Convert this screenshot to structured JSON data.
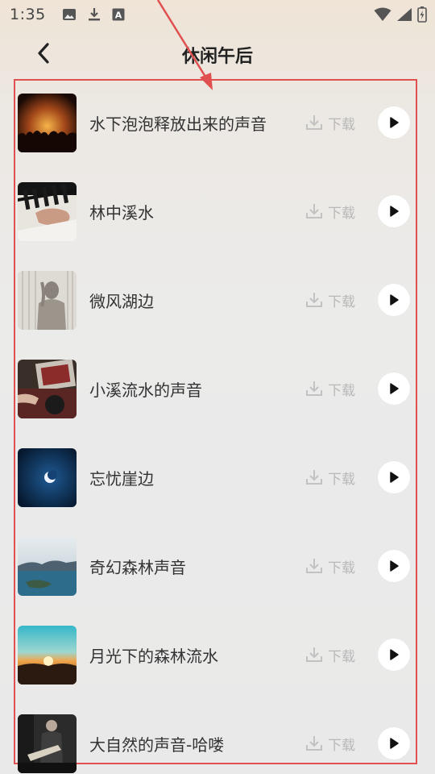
{
  "status_bar": {
    "time": "1:35",
    "left_icons": [
      "image-icon",
      "download-icon",
      "font-icon"
    ],
    "right_icons": [
      "wifi-icon",
      "signal-icon",
      "battery-icon"
    ]
  },
  "header": {
    "title": "休闲午后",
    "back_icon": "chevron-left-icon"
  },
  "tracks": [
    {
      "title": "水下泡泡释放出来的声音",
      "download_label": "下载",
      "thumb": "concert-crowd"
    },
    {
      "title": "林中溪水",
      "download_label": "下载",
      "thumb": "piano-hands"
    },
    {
      "title": "微风湖边",
      "download_label": "下载",
      "thumb": "curtain-silhouette"
    },
    {
      "title": "小溪流水的声音",
      "download_label": "下载",
      "thumb": "vinyl-player"
    },
    {
      "title": "忘忧崖边",
      "download_label": "下载",
      "thumb": "moon-night"
    },
    {
      "title": "奇幻森林声音",
      "download_label": "下载",
      "thumb": "coast-island"
    },
    {
      "title": "月光下的森林流水",
      "download_label": "下载",
      "thumb": "sunset-hills"
    },
    {
      "title": "大自然的声音-哈喽",
      "download_label": "下载",
      "thumb": "guitar-player"
    }
  ],
  "colors": {
    "annotation_red": "#e05050",
    "download_gray": "#b8b8b8",
    "play_bg": "#ffffff"
  }
}
